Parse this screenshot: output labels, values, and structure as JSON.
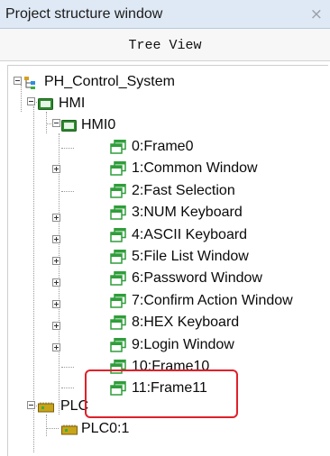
{
  "window": {
    "title": "Project structure window",
    "close_glyph": "×"
  },
  "tab": {
    "label": "Tree View"
  },
  "tree": {
    "root": {
      "label": "PH_Control_System",
      "icon": "project-tree-icon"
    },
    "hmi_group": {
      "label": "HMI",
      "icon": "monitor-icon"
    },
    "hmi0": {
      "label": "HMI0",
      "icon": "monitor-icon"
    },
    "frames": [
      {
        "label": "0:Frame0",
        "expandable": false,
        "icon": "frame-window-icon"
      },
      {
        "label": "1:Common Window",
        "expandable": true,
        "icon": "frame-window-icon"
      },
      {
        "label": "2:Fast Selection",
        "expandable": false,
        "icon": "frame-window-icon"
      },
      {
        "label": "3:NUM Keyboard",
        "expandable": true,
        "icon": "frame-window-icon"
      },
      {
        "label": "4:ASCII Keyboard",
        "expandable": true,
        "icon": "frame-window-icon"
      },
      {
        "label": "5:File List Window",
        "expandable": true,
        "icon": "frame-window-icon"
      },
      {
        "label": "6:Password Window",
        "expandable": true,
        "icon": "frame-window-icon"
      },
      {
        "label": "7:Confirm Action Window",
        "expandable": true,
        "icon": "frame-window-icon"
      },
      {
        "label": "8:HEX Keyboard",
        "expandable": true,
        "icon": "frame-window-icon"
      },
      {
        "label": "9:Login Window",
        "expandable": true,
        "icon": "frame-window-icon"
      },
      {
        "label": "10:Frame10",
        "expandable": false,
        "icon": "frame-window-icon"
      },
      {
        "label": "11:Frame11",
        "expandable": false,
        "icon": "frame-window-icon"
      }
    ],
    "plc_group": {
      "label": "PLC",
      "icon": "plc-icon"
    },
    "plc0": {
      "label": "PLC0:1",
      "icon": "plc-icon"
    }
  },
  "colors": {
    "title_bg": "#dfe9f5",
    "frame_icon_green": "#2f9e3a",
    "monitor_green": "#2c8a2c",
    "highlight_red": "#e0202a"
  }
}
